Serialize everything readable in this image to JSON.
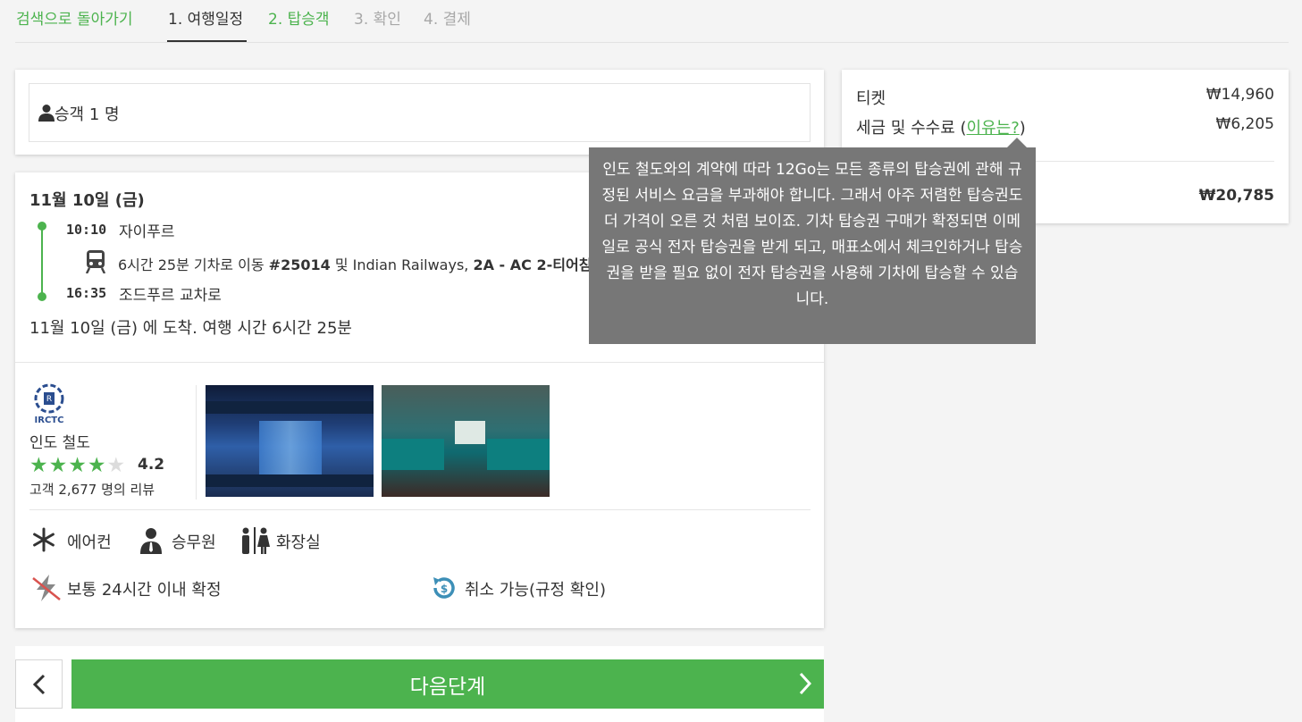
{
  "nav": {
    "back": "검색으로 돌아가기",
    "step1": "1. 여행일정",
    "step2": "2. 탑승객",
    "step3": "3. 확인",
    "step4": "4. 결제"
  },
  "passengers": {
    "label": "승객 1 명"
  },
  "trip": {
    "date": "11월 10일 (금)",
    "departure_time": "10:10",
    "departure_place": "자이푸르",
    "duration_prefix": "6시간 25분 기차로 이동 ",
    "train_no": "#25014",
    "operator_mid": " 및 Indian Railways, ",
    "class_name": "2A - AC 2-티어침",
    "arrival_time": "16:35",
    "arrival_place": "조드푸르 교차로",
    "arrival_summary": "11월 10일 (금) 에 도착. 여행 시간 6시간 25분"
  },
  "operator": {
    "logo_text": "IRCTC",
    "name": "인도 철도",
    "rating": "4.2",
    "stars_filled": 4,
    "stars_total": 5,
    "reviews": "고객 2,677 명의 리뷰"
  },
  "amenities": {
    "ac": "에어컨",
    "attendant": "승무원",
    "toilet": "화장실",
    "confirmation": "보통 24시간 이내 확정",
    "cancellation": "취소 가능(규정 확인)"
  },
  "buttons": {
    "next": "다음단계"
  },
  "price": {
    "ticket_label": "티켓",
    "ticket_value": "₩14,960",
    "fee_label_pre": "세금 및 수수료 (",
    "fee_link": "이유는?",
    "fee_label_post": ")",
    "fee_value": "₩6,205",
    "total_value": "₩20,785"
  },
  "tooltip": {
    "text": "인도 철도와의 계약에 따라 12Go는 모든 종류의 탑승권에 관해 규정된 서비스 요금을 부과해야 합니다. 그래서 아주 저렴한 탑승권도 더 가격이 오른 것 처럼 보이죠. 기차 탑승권 구매가 확정되면 이메일로 공식 전자 탑승권을 받게 되고, 매표소에서 체크인하거나 탑승권을 받을 필요 없이 전자 탑승권을 사용해 기차에 탑승할 수 있습니다."
  },
  "colors": {
    "accent": "#4cb34e",
    "tooltip_bg": "#777777",
    "text": "#333333"
  }
}
